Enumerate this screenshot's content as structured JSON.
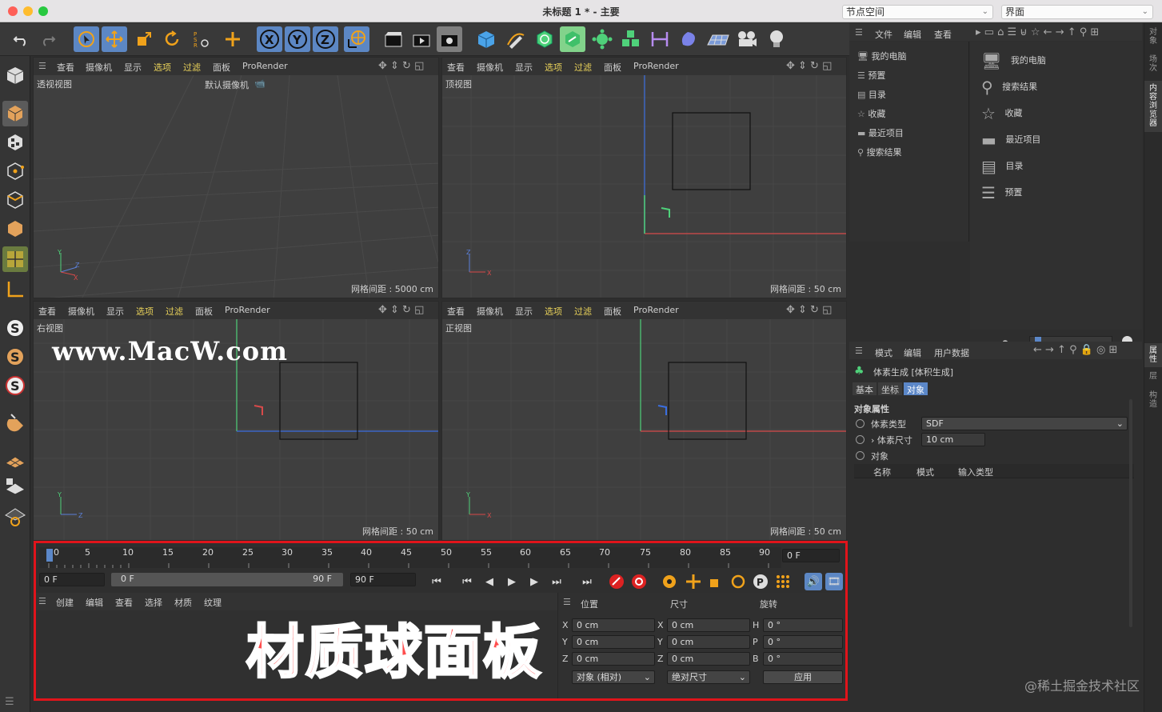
{
  "window": {
    "title": "未标题 1 * - 主要",
    "node_space": "节点空间",
    "layout": "界面"
  },
  "viewport_menu": [
    "查看",
    "摄像机",
    "显示",
    "选项",
    "过滤",
    "面板",
    "ProRender"
  ],
  "viewports": {
    "perspective": {
      "name": "透视视图",
      "camera": "默认摄像机",
      "grid": "网格间距 : 5000 cm"
    },
    "top": {
      "name": "顶视图",
      "grid": "网格间距 : 50 cm"
    },
    "right": {
      "name": "右视图",
      "grid": "网格间距 : 50 cm"
    },
    "front": {
      "name": "正视图",
      "grid": "网格间距 : 50 cm"
    }
  },
  "timeline": {
    "ticks": [
      "0",
      "5",
      "10",
      "15",
      "20",
      "25",
      "30",
      "35",
      "40",
      "45",
      "50",
      "55",
      "60",
      "65",
      "70",
      "75",
      "80",
      "85",
      "90"
    ],
    "current_frame": "0 F",
    "start_frame": "0 F",
    "range_start": "0 F",
    "range_end": "90 F",
    "end_frame": "90 F"
  },
  "material_menu": [
    "创建",
    "编辑",
    "查看",
    "选择",
    "材质",
    "纹理"
  ],
  "coord": {
    "headers": {
      "position": "位置",
      "size": "尺寸",
      "rotation": "旋转"
    },
    "rows": [
      {
        "axis": "X",
        "pos": "0 cm",
        "saxis": "X",
        "size": "0 cm",
        "raxis": "H",
        "rot": "0 °"
      },
      {
        "axis": "Y",
        "pos": "0 cm",
        "saxis": "Y",
        "size": "0 cm",
        "raxis": "P",
        "rot": "0 °"
      },
      {
        "axis": "Z",
        "pos": "0 cm",
        "saxis": "Z",
        "size": "0 cm",
        "raxis": "B",
        "rot": "0 °"
      }
    ],
    "mode": "对象 (相对)",
    "size_mode": "绝对尺寸",
    "apply": "应用"
  },
  "browser": {
    "menu": [
      "文件",
      "编辑",
      "查看"
    ],
    "tree": [
      "我的电脑",
      "预置",
      "目录",
      "收藏",
      "最近项目",
      "搜索结果"
    ],
    "list": [
      "我的电脑",
      "搜索结果",
      "收藏",
      "最近项目",
      "目录",
      "预置"
    ]
  },
  "side_tabs_top": [
    "对象",
    "场次",
    "内容浏览器"
  ],
  "side_tabs_bottom": [
    "属性",
    "层",
    "构造"
  ],
  "attributes": {
    "menu": [
      "模式",
      "编辑",
      "用户数据"
    ],
    "object": "体素生成 [体积生成]",
    "tabs": [
      "基本",
      "坐标",
      "对象"
    ],
    "section": "对象属性",
    "voxel_type_label": "体素类型",
    "voxel_type_value": "SDF",
    "voxel_size_label": "体素尺寸",
    "voxel_size_value": "10 cm",
    "objects_label": "对象",
    "table_headers": [
      "名称",
      "模式",
      "输入类型"
    ]
  },
  "overlay": {
    "watermark": "www.MacW.com",
    "caption": "材质球面板",
    "corner": "@稀土掘金技术社区"
  }
}
